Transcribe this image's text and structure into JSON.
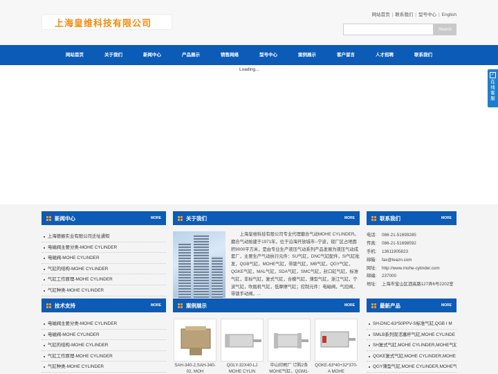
{
  "header": {
    "logo_text": "上海皇维科技有限公司",
    "toplinks": [
      "网站首页",
      "联系我们",
      "型号中心",
      "English"
    ],
    "search_placeholder": "",
    "search_button": "Search"
  },
  "nav": [
    "网站首页",
    "关于我们",
    "新闻中心",
    "产品展示",
    "销售网络",
    "型号中心",
    "案例展示",
    "客户留言",
    "人才招聘",
    "联系我们"
  ],
  "banner": {
    "loading": "Loading..."
  },
  "sidefloat": {
    "text": "在线客服"
  },
  "news": {
    "title": "新闻中心",
    "more": "MORE",
    "items": [
      "上海德振实业有限公司迁址通知",
      "电磁阀主要分类-MOHE CYLINDER",
      "电磁阀-MOHE CYLINDER",
      "气缸的结构-MOHE CYLINDER",
      "气缸工作原理-MOHE CYLINDER",
      "气缸种类-MOHE CYLINDER"
    ]
  },
  "about": {
    "title": "关于我们",
    "more": "MORE",
    "text": "上海皇维科技有限公司专业代理磨合气动MOHE CYLINDER。磨合气动始建于1971年，位于沿海开放城市--宁波，现厂区占地面积9000平方米，是由专业生产液压气动系列产品发展为液压气动成套厂，主要生产气动执行元件：SU气缸，DNC气缸配件，SI气缸批发，QGB气缸，MOHE气缸，带锁气缸，MB气缸，QGY气缸，QGKE气缸，MAL气缸，SDA气缸，SMC气缸，封口缸气缸，标准气缸，非标气缸，复式气缸，合模气缸，薄型气缸，浙江气缸，宁波气缸，吹瓶机气缸，低摩擦气缸；控制元件：电磁阀，气控阀，带锁手动阀，..."
  },
  "contact": {
    "title": "联系我们",
    "more": "MORE",
    "rows": [
      {
        "k": "电话:",
        "v": "086-21-51699285"
      },
      {
        "k": "传真:",
        "v": "086-21-51698592"
      },
      {
        "k": "手机:",
        "v": "13611905823"
      },
      {
        "k": "邮箱:",
        "v": "fax@leazn.com"
      },
      {
        "k": "网址:",
        "v": "http://www.mohe-cylinder.com"
      },
      {
        "k": "邮编:",
        "v": "237000"
      },
      {
        "k": "地址:",
        "v": "上海市宝山区泗高路127弄6号2202室"
      }
    ]
  },
  "support": {
    "title": "技术支持",
    "more": "MORE",
    "items": [
      "电磁阀主要分类-MOHE CYLINDER",
      "电磁阀-MOHE CYLINDER",
      "气缸的结构-MOHE CYLINDER",
      "气缸工作原理-MOHE CYLINDER",
      "气缸种类-MOHE CYLINDER"
    ]
  },
  "cases": {
    "title": "案例展示",
    "more": "MORE",
    "items": [
      "SAH-340-2,SAH-340-02, MOH",
      "QGLY-32X40-LJ MOHE CYLIN",
      "中山印刷厂 订购2条MOHE气缸，QGM1-80X",
      "QGKE-63*40+32*370-A MOHE"
    ]
  },
  "products": {
    "title": "最新产品",
    "more": "MORE",
    "items": [
      "SH-DNC-63*50PPV-S标准气缸,QGB I M",
      "SMLB系列双活塞杆气缸,MOHE CYLINDE",
      "SH复式气缸,MOHE CYLINDER,MOHE气缸",
      "QGKE复式气缸,MOHE CYLINDER,MOHE",
      "QGY薄型气缸,MOHE CYLINDER,MOHE气"
    ]
  }
}
